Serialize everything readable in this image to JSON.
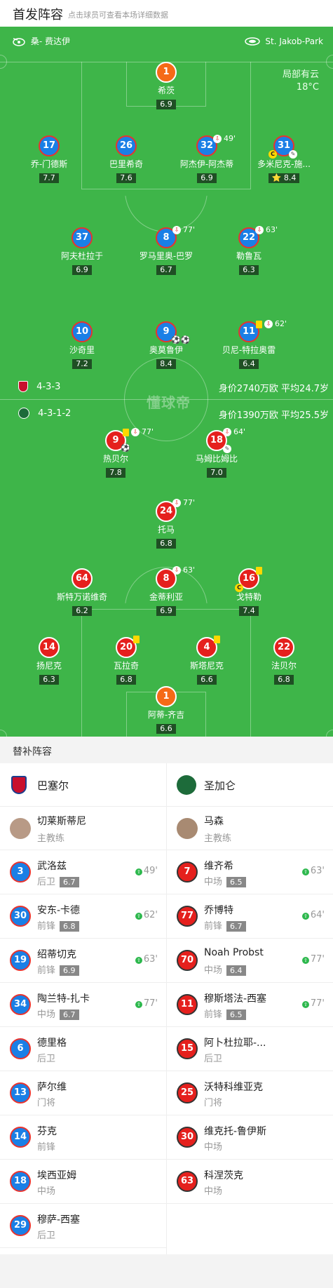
{
  "header": {
    "title": "首发阵容",
    "subtitle": "点击球员可查看本场详细数据"
  },
  "pitch": {
    "referee": "桑- 费达伊",
    "stadium": "St. Jakob-Park",
    "weather": "局部有云",
    "temp": "18°C",
    "home_formation": "4-3-3",
    "home_value": "身价2740万欧 平均24.7岁",
    "away_formation": "4-3-1-2",
    "away_value": "身价1390万欧 平均25.5岁",
    "watermark": "懂球帝"
  },
  "home": [
    {
      "num": "1",
      "name": "希茨",
      "rating": "6.9",
      "kind": "o"
    },
    {
      "num": "17",
      "name": "乔-门德斯",
      "rating": "7.7",
      "kind": "b"
    },
    {
      "num": "26",
      "name": "巴里希奇",
      "rating": "7.6",
      "kind": "b"
    },
    {
      "num": "32",
      "name": "阿杰伊-阿杰蒂",
      "rating": "6.9",
      "kind": "b",
      "sub": "49'"
    },
    {
      "num": "31",
      "name": "多米尼克-施...",
      "rating": "8.4",
      "kind": "b",
      "star": "⭐"
    },
    {
      "num": "37",
      "name": "阿夫杜拉于",
      "rating": "6.9",
      "kind": "b"
    },
    {
      "num": "8",
      "name": "罗马里奥-巴罗",
      "rating": "6.7",
      "kind": "b",
      "sub": "77'"
    },
    {
      "num": "22",
      "name": "勒鲁瓦",
      "rating": "6.3",
      "kind": "b",
      "sub": "63'"
    },
    {
      "num": "10",
      "name": "沙奇里",
      "rating": "7.2",
      "kind": "b"
    },
    {
      "num": "9",
      "name": "奥莫鲁伊",
      "rating": "8.4",
      "kind": "b"
    },
    {
      "num": "11",
      "name": "贝尼-特拉奥雷",
      "rating": "6.4",
      "kind": "b",
      "sub": "62'"
    }
  ],
  "away": [
    {
      "num": "9",
      "name": "热贝尔",
      "rating": "7.8",
      "kind": "r",
      "sub": "77'"
    },
    {
      "num": "18",
      "name": "马姆比姆比",
      "rating": "7.0",
      "kind": "r",
      "sub": "64'"
    },
    {
      "num": "24",
      "name": "托马",
      "rating": "6.8",
      "kind": "r",
      "sub": "77'"
    },
    {
      "num": "64",
      "name": "斯特万诺维奇",
      "rating": "6.2",
      "kind": "r"
    },
    {
      "num": "8",
      "name": "金蒂利亚",
      "rating": "6.9",
      "kind": "r",
      "sub": "63'"
    },
    {
      "num": "16",
      "name": "戈特勒",
      "rating": "7.4",
      "kind": "r"
    },
    {
      "num": "14",
      "name": "扬尼克",
      "rating": "6.3",
      "kind": "r"
    },
    {
      "num": "20",
      "name": "瓦拉奇",
      "rating": "6.8",
      "kind": "r"
    },
    {
      "num": "4",
      "name": "斯塔尼克",
      "rating": "6.6",
      "kind": "r"
    },
    {
      "num": "22",
      "name": "法贝尔",
      "rating": "6.8",
      "kind": "r"
    },
    {
      "num": "1",
      "name": "阿蒂-齐吉",
      "rating": "6.6",
      "kind": "o"
    }
  ],
  "subs": {
    "title": "替补阵容",
    "home_team": "巴塞尔",
    "away_team": "圣加仑",
    "home_coach": {
      "name": "切莱斯蒂尼",
      "role": "主教练"
    },
    "away_coach": {
      "name": "马森",
      "role": "主教练"
    },
    "home": [
      {
        "num": "3",
        "name": "武洛兹",
        "pos": "后卫",
        "rating": "6.7",
        "time": "49'"
      },
      {
        "num": "30",
        "name": "安东-卡德",
        "pos": "前锋",
        "rating": "6.8",
        "time": "62'"
      },
      {
        "num": "19",
        "name": "绍蒂切克",
        "pos": "前锋",
        "rating": "6.9",
        "time": "63'"
      },
      {
        "num": "34",
        "name": "陶兰特-扎卡",
        "pos": "中场",
        "rating": "6.7",
        "time": "77'"
      },
      {
        "num": "6",
        "name": "德里格",
        "pos": "后卫"
      },
      {
        "num": "13",
        "name": "萨尔维",
        "pos": "门将"
      },
      {
        "num": "14",
        "name": "芬克",
        "pos": "前锋"
      },
      {
        "num": "18",
        "name": "埃西亚姆",
        "pos": "中场"
      },
      {
        "num": "29",
        "name": "穆萨-西塞",
        "pos": "后卫"
      }
    ],
    "away": [
      {
        "num": "7",
        "name": "维齐希",
        "pos": "中场",
        "rating": "6.5",
        "time": "63'"
      },
      {
        "num": "77",
        "name": "乔博特",
        "pos": "前锋",
        "rating": "6.7",
        "time": "64'"
      },
      {
        "num": "70",
        "name": "Noah Probst",
        "pos": "中场",
        "rating": "6.4",
        "time": "77'"
      },
      {
        "num": "11",
        "name": "穆斯塔法-西塞",
        "pos": "前锋",
        "rating": "6.5",
        "time": "77'"
      },
      {
        "num": "15",
        "name": "阿卜杜拉耶-...",
        "pos": "后卫"
      },
      {
        "num": "25",
        "name": "沃特科维亚克",
        "pos": "门将"
      },
      {
        "num": "30",
        "name": "维克托-鲁伊斯",
        "pos": "中场"
      },
      {
        "num": "63",
        "name": "科涅茨克",
        "pos": "中场"
      }
    ]
  }
}
